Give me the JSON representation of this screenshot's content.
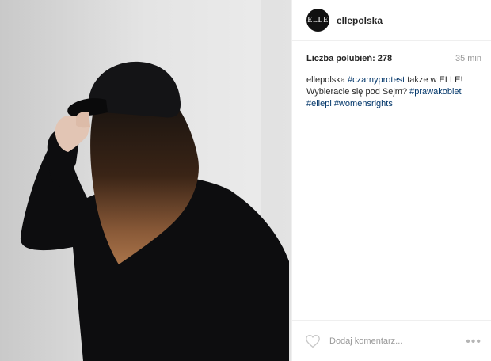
{
  "post": {
    "username": "ellepolska",
    "avatar_text": "ELLE",
    "likes_label": "Liczba polubień:",
    "likes_count": "278",
    "time_ago": "35 min",
    "caption": {
      "user": "ellepolska",
      "segments": [
        {
          "type": "hashtag",
          "text": "#czarnyprotest"
        },
        {
          "type": "text",
          "text": " także w ELLE! Wybieracie się pod Sejm? "
        },
        {
          "type": "hashtag",
          "text": "#prawakobiet"
        },
        {
          "type": "text",
          "text": " "
        },
        {
          "type": "hashtag",
          "text": "#ellepl"
        },
        {
          "type": "text",
          "text": " "
        },
        {
          "type": "hashtag",
          "text": "#womensrights"
        }
      ]
    },
    "comment_placeholder": "Dodaj komentarz...",
    "more_label": "•••"
  },
  "icons": {
    "like": "heart-icon",
    "more": "more-options-icon"
  },
  "colors": {
    "hashtag": "#003569",
    "muted": "#999999",
    "text": "#262626",
    "border": "#efefef"
  }
}
